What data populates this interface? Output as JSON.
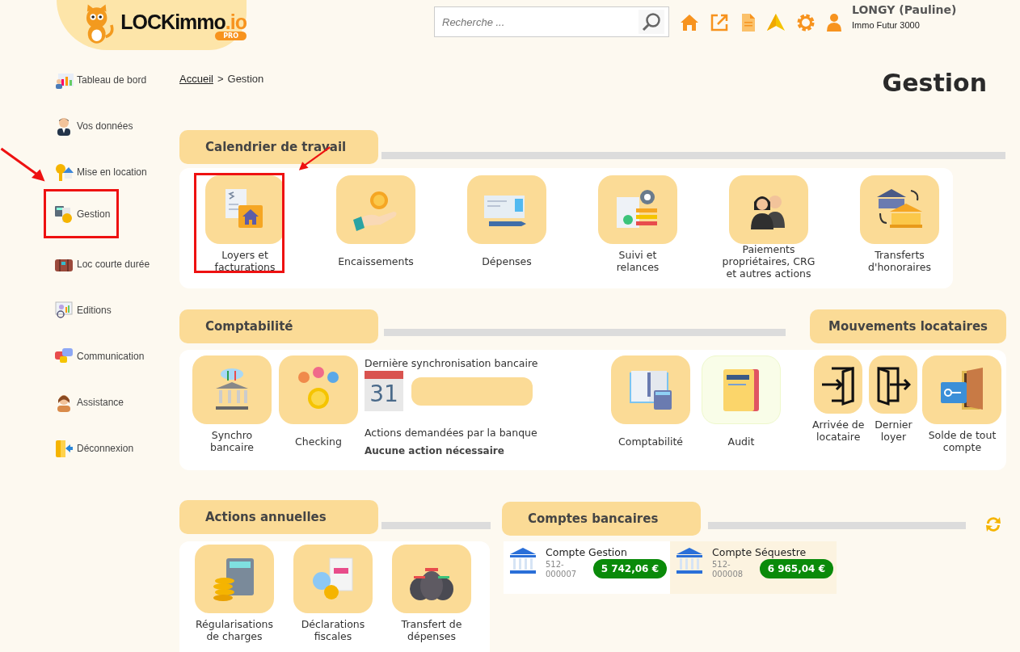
{
  "header": {
    "logo": {
      "name": "LOCKimmo",
      "suffix": ".io",
      "badge": "PRO"
    },
    "search": {
      "placeholder": "Recherche ..."
    },
    "user": {
      "name": "LONGY (Pauline)",
      "company": "Immo Futur 3000"
    }
  },
  "sidebar": {
    "items": [
      {
        "label": "Tableau de bord",
        "highlighted": false
      },
      {
        "label": "Vos données",
        "highlighted": false
      },
      {
        "label": "Mise en location",
        "highlighted": false
      },
      {
        "label": "Gestion",
        "highlighted": true
      },
      {
        "label": "Loc courte durée",
        "highlighted": false
      },
      {
        "label": "Editions",
        "highlighted": false
      },
      {
        "label": "Communication",
        "highlighted": false
      },
      {
        "label": "Assistance",
        "highlighted": false
      },
      {
        "label": "Déconnexion",
        "highlighted": false
      }
    ]
  },
  "breadcrumb": {
    "link": "Accueil",
    "separator": ">",
    "current": "Gestion"
  },
  "page_title": "Gestion",
  "calendrier": {
    "title": "Calendrier de travail",
    "tiles": [
      {
        "label": "Loyers et\nfacturations",
        "highlighted": true
      },
      {
        "label": "Encaissements",
        "highlighted": false
      },
      {
        "label": "Dépenses",
        "highlighted": false
      },
      {
        "label": "Suivi et\nrelances",
        "highlighted": false
      },
      {
        "label": "Paiements\npropriétaires, CRG\net autres actions",
        "highlighted": false
      },
      {
        "label": "Transferts\nd'honoraires",
        "highlighted": false
      }
    ]
  },
  "comptabilite": {
    "title": "Comptabilité",
    "tiles": [
      {
        "label": "Synchro\nbancaire"
      },
      {
        "label": "Checking"
      }
    ],
    "sync": {
      "label": "Dernière synchronisation bancaire",
      "calendar_day": "31",
      "actions_label": "Actions demandées par la banque",
      "actions_value": "Aucune action nécessaire"
    },
    "tiles_right": [
      {
        "label": "Comptabilité",
        "kind": "standard"
      },
      {
        "label": "Audit",
        "kind": "light"
      }
    ]
  },
  "mouvements": {
    "title": "Mouvements locataires",
    "tiles": [
      {
        "label": "Arrivée de\nlocataire",
        "kind": "small"
      },
      {
        "label": "Dernier\nloyer",
        "kind": "small"
      },
      {
        "label": "Solde de tout\ncompte",
        "kind": "standard"
      }
    ]
  },
  "actions_annuelles": {
    "title": "Actions annuelles",
    "tiles": [
      {
        "label": "Régularisations\nde charges"
      },
      {
        "label": "Déclarations\nfiscales"
      },
      {
        "label": "Transfert de\ndépenses"
      }
    ]
  },
  "comptes_bancaires": {
    "title": "Comptes bancaires",
    "accounts": [
      {
        "name": "Compte Gestion",
        "number": "512-\n000007",
        "balance": "5 742,06 €",
        "selected": false
      },
      {
        "name": "Compte Séquestre",
        "number": "512-\n000008",
        "balance": "6 965,04 €",
        "selected": true
      }
    ]
  }
}
